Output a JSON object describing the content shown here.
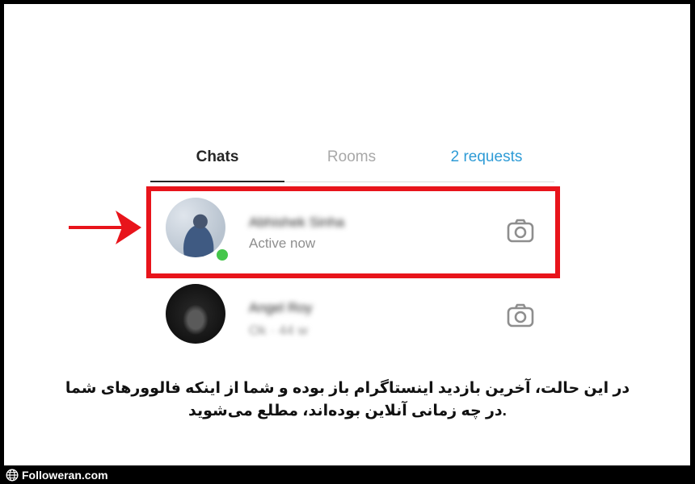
{
  "tabs": [
    {
      "label": "Chats",
      "active": true
    },
    {
      "label": "Rooms",
      "active": false
    },
    {
      "label": "2 requests",
      "active": false
    }
  ],
  "chats": [
    {
      "name": "Abhishek Sinha",
      "status": "Active now",
      "online": true,
      "camera_icon": "camera-icon"
    },
    {
      "name": "Angel Roy",
      "status": "Ok · 44 w",
      "online": false,
      "camera_icon": "camera-icon"
    }
  ],
  "caption": {
    "line1": "در این حالت، آخرین بازدید اینستاگرام باز بوده و شما از اینکه فالوورهای شما",
    "line2": ".در چه زمانی آنلاین بوده‌اند، مطلع می‌شوید"
  },
  "footer": {
    "site": "Followeran.com",
    "icon": "globe-icon"
  },
  "colors": {
    "highlight": "#e8141b",
    "online": "#45c64b",
    "link": "#2e9bd6"
  }
}
